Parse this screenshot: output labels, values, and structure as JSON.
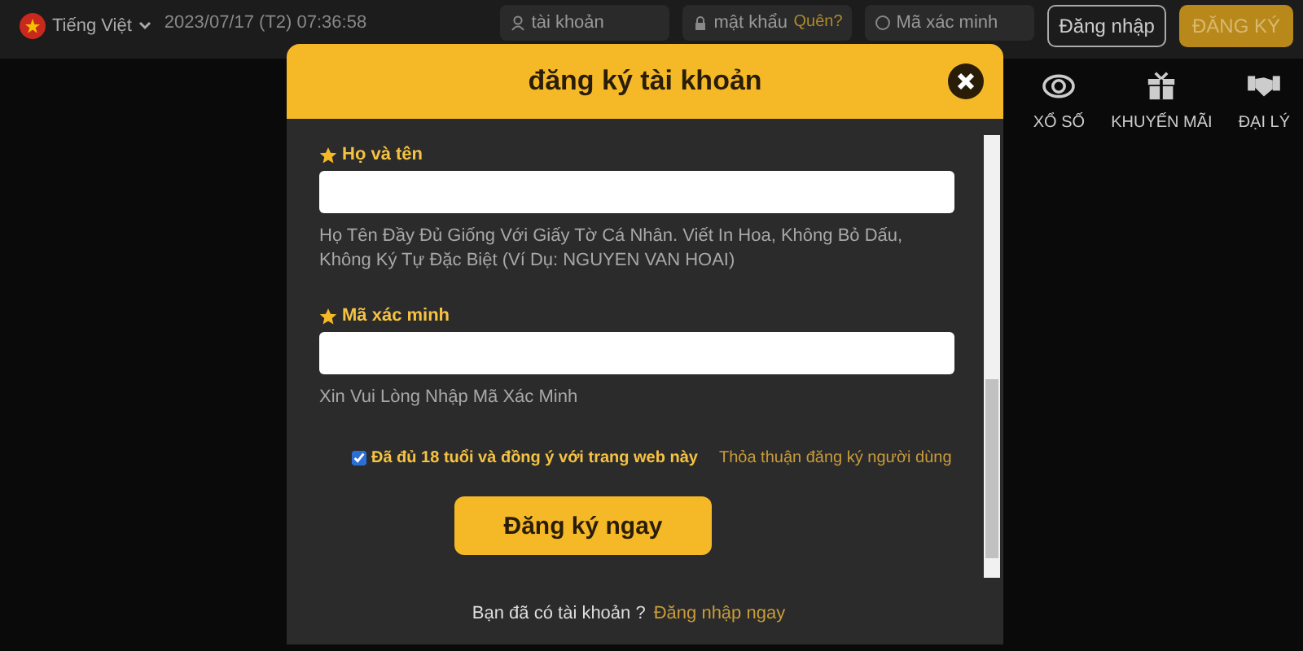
{
  "topbar": {
    "language": "Tiếng Việt",
    "datetime": "2023/07/17 (T2) 07:36:58",
    "fields": [
      {
        "kind": "user",
        "placeholder": "tài khoản"
      },
      {
        "kind": "password",
        "placeholder": "mật khẩu",
        "link": "Quên?"
      },
      {
        "kind": "captcha",
        "placeholder": "Mã xác minh"
      }
    ],
    "login": "Đăng nhập",
    "register": "ĐĂNG KÝ"
  },
  "nav": [
    {
      "kind": "lottery",
      "label": "XỔ SỐ"
    },
    {
      "kind": "gift",
      "label": "KHUYẾN MÃI"
    },
    {
      "kind": "handshake",
      "label": "ĐẠI LÝ"
    }
  ],
  "modal": {
    "title": "đăng ký tài khoản",
    "fields": [
      {
        "label": "Họ và tên",
        "hint": "Họ Tên Đầy Đủ Giống Với Giấy Tờ Cá Nhân. Viết In Hoa, Không Bỏ Dấu, Không Ký Tự Đặc Biệt (Ví Dụ: NGUYEN VAN HOAI)"
      },
      {
        "label": "Mã xác minh",
        "hint": "Xin Vui Lòng Nhập Mã Xác Minh"
      }
    ],
    "agreement": {
      "checked": true,
      "label": "Đã đủ 18 tuổi và đồng ý với trang web này",
      "link": "Thỏa thuận đăng ký người dùng"
    },
    "submit": "Đăng ký ngay",
    "footer": {
      "text": "Bạn đã có tài khoản ?",
      "link": "Đăng nhập ngay"
    }
  }
}
